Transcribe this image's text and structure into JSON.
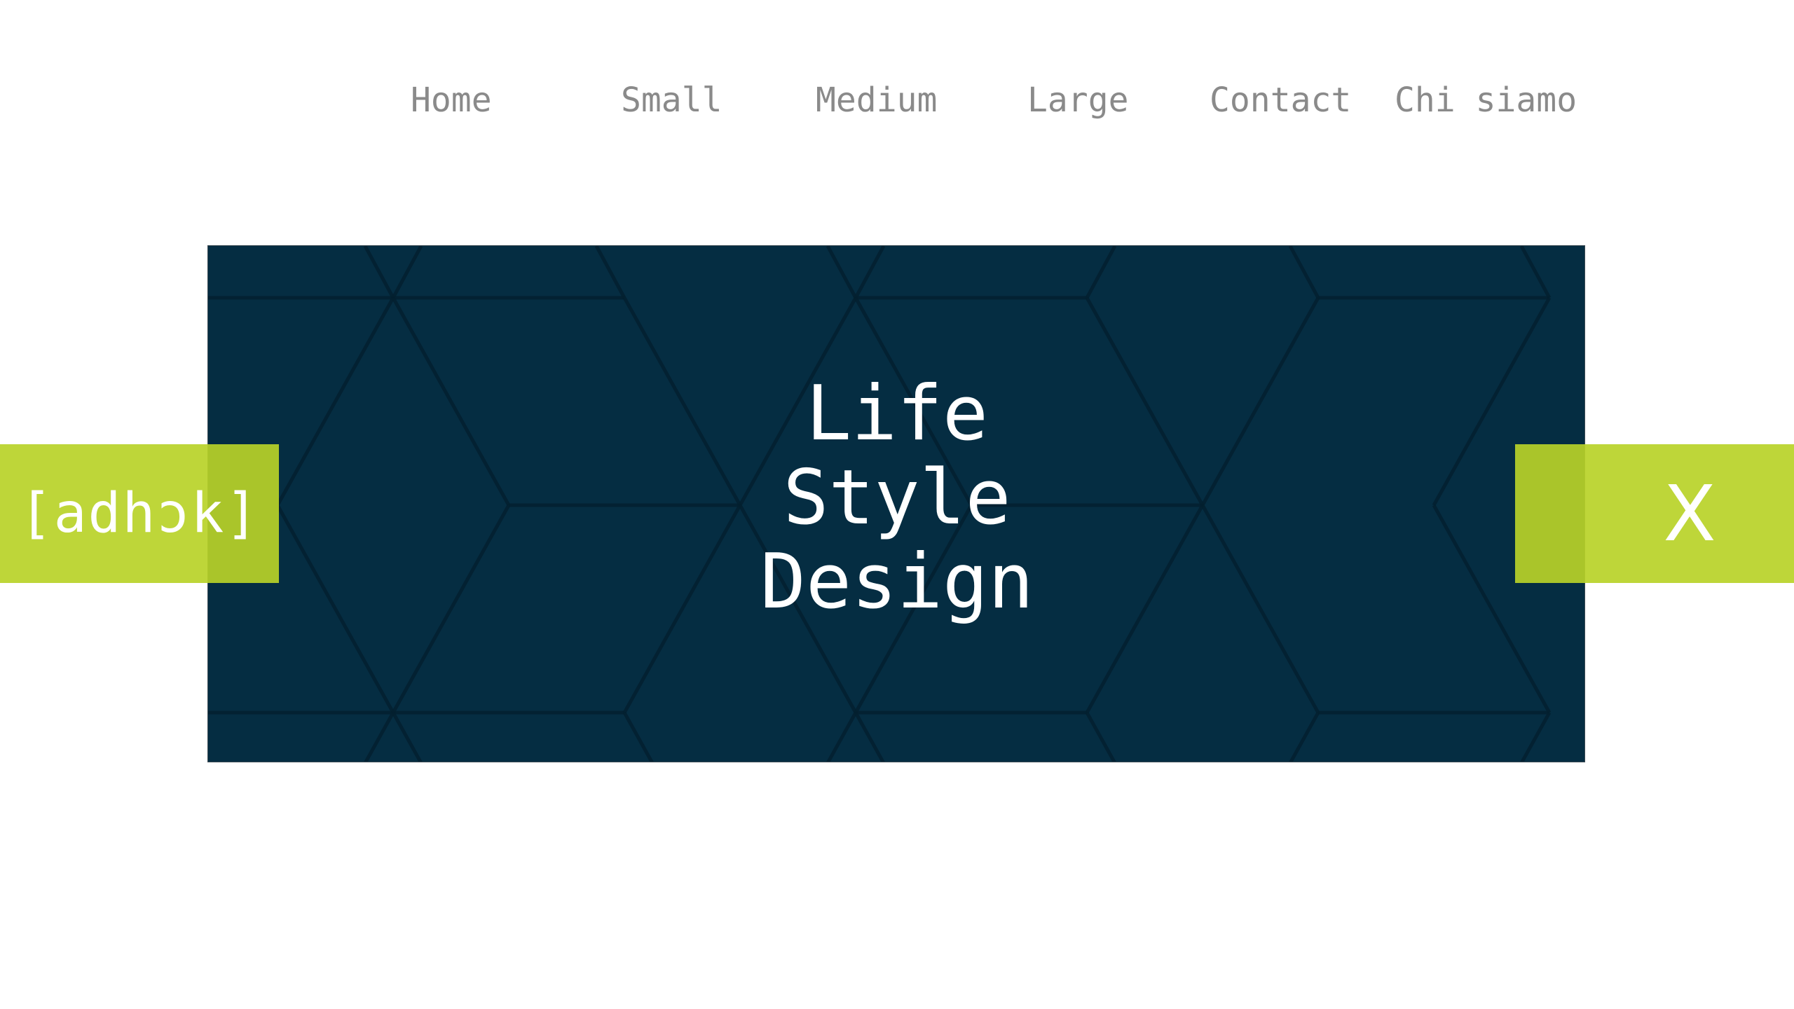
{
  "nav": {
    "items": [
      {
        "label": "Home"
      },
      {
        "label": "Small"
      },
      {
        "label": "Medium"
      },
      {
        "label": "Large"
      },
      {
        "label": "Contact"
      },
      {
        "label": "Chi siamo"
      }
    ]
  },
  "hero": {
    "title_lines": [
      "Life",
      "Style",
      "Design"
    ],
    "background_color": "#052d42",
    "pattern": "hexagon-outline"
  },
  "logo": {
    "text": "[adhɔk]",
    "background_color": "#b9d328"
  },
  "close": {
    "label": "X",
    "icon": "close-icon",
    "background_color": "#b9d328"
  }
}
